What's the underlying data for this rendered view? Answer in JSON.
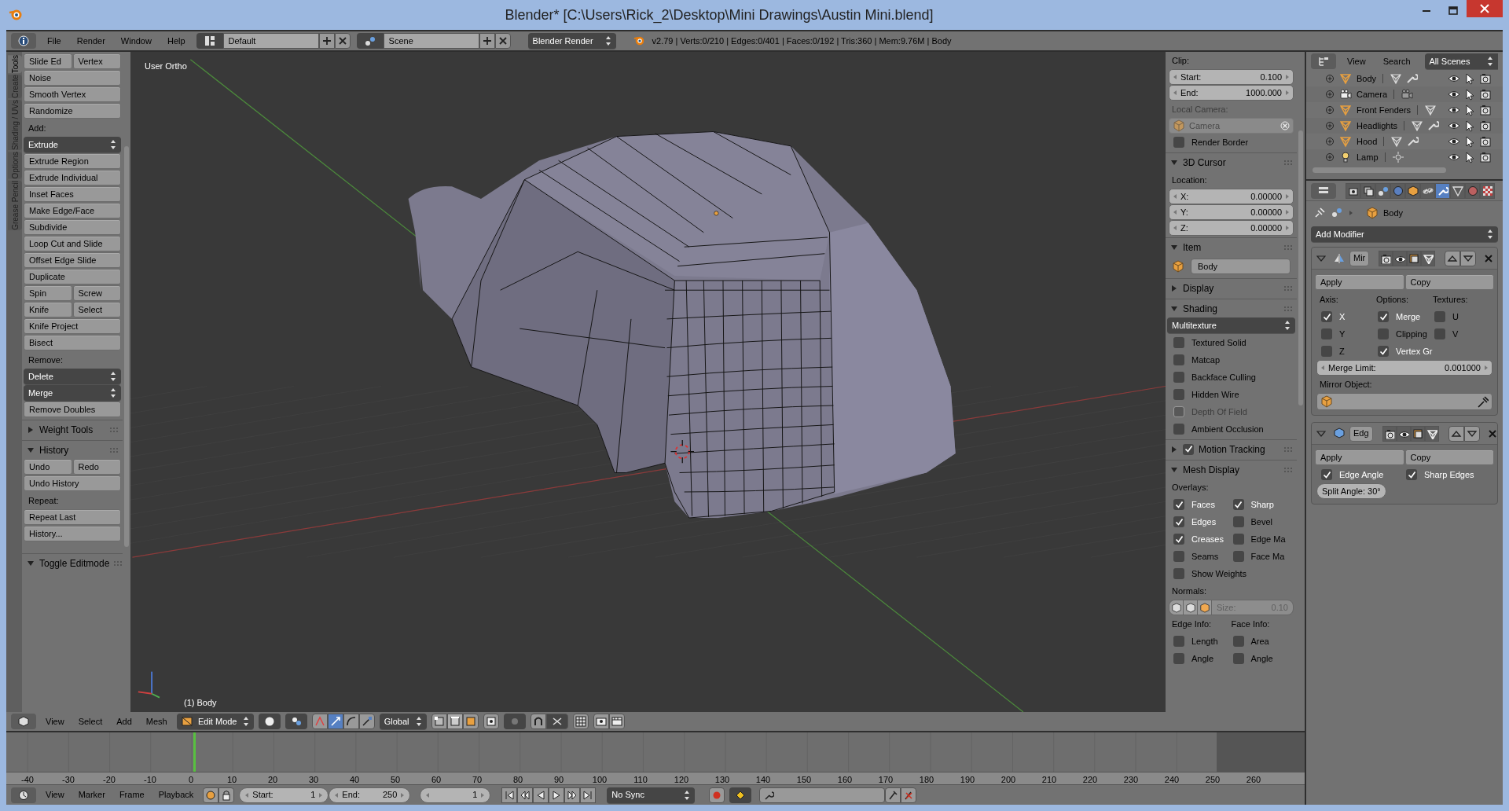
{
  "window": {
    "title": "Blender* [C:\\Users\\Rick_2\\Desktop\\Mini Drawings\\Austin Mini.blend]"
  },
  "info_header": {
    "menus": [
      "File",
      "Render",
      "Window",
      "Help"
    ],
    "screen_layout": "Default",
    "scene": "Scene",
    "render_engine": "Blender Render",
    "stats": "v2.79 | Verts:0/210 | Edges:0/401 | Faces:0/192 | Tris:360 | Mem:9.76M | Body"
  },
  "tool_shelf": {
    "tabs": [
      {
        "label": "Tools",
        "selected": true
      },
      {
        "label": "Create",
        "selected": false
      },
      {
        "label": "Shading / UVs",
        "selected": false
      },
      {
        "label": "Options",
        "selected": false
      },
      {
        "label": "Grease Pencil",
        "selected": false
      }
    ],
    "rows": [
      {
        "kind": "buttons",
        "labels": [
          "Slide Ed",
          "Vertex"
        ]
      },
      {
        "kind": "buttons",
        "labels": [
          "Noise"
        ]
      },
      {
        "kind": "buttons",
        "labels": [
          "Smooth Vertex"
        ]
      },
      {
        "kind": "buttons",
        "labels": [
          "Randomize"
        ]
      },
      {
        "kind": "label",
        "text": "Add:"
      },
      {
        "kind": "dropdown",
        "text": "Extrude"
      },
      {
        "kind": "buttons",
        "labels": [
          "Extrude Region"
        ]
      },
      {
        "kind": "buttons",
        "labels": [
          "Extrude Individual"
        ]
      },
      {
        "kind": "buttons",
        "labels": [
          "Inset Faces"
        ]
      },
      {
        "kind": "buttons",
        "labels": [
          "Make Edge/Face"
        ]
      },
      {
        "kind": "buttons",
        "labels": [
          "Subdivide"
        ]
      },
      {
        "kind": "buttons",
        "labels": [
          "Loop Cut and Slide"
        ]
      },
      {
        "kind": "buttons",
        "labels": [
          "Offset Edge Slide"
        ]
      },
      {
        "kind": "buttons",
        "labels": [
          "Duplicate"
        ]
      },
      {
        "kind": "buttons",
        "labels": [
          "Spin",
          "Screw"
        ]
      },
      {
        "kind": "buttons",
        "labels": [
          "Knife",
          "Select"
        ]
      },
      {
        "kind": "buttons",
        "labels": [
          "Knife Project"
        ]
      },
      {
        "kind": "buttons",
        "labels": [
          "Bisect"
        ]
      },
      {
        "kind": "label",
        "text": "Remove:"
      },
      {
        "kind": "dropdown",
        "text": "Delete"
      },
      {
        "kind": "dropdown",
        "text": "Merge"
      },
      {
        "kind": "buttons",
        "labels": [
          "Remove Doubles"
        ]
      },
      {
        "kind": "panel",
        "text": "Weight Tools",
        "expanded": false
      },
      {
        "kind": "panel",
        "text": "History",
        "expanded": true
      },
      {
        "kind": "buttons",
        "labels": [
          "Undo",
          "Redo"
        ]
      },
      {
        "kind": "buttons",
        "labels": [
          "Undo History"
        ]
      },
      {
        "kind": "label",
        "text": "Repeat:"
      },
      {
        "kind": "buttons",
        "labels": [
          "Repeat Last"
        ]
      },
      {
        "kind": "buttons",
        "labels": [
          "History..."
        ]
      }
    ],
    "footer_panel": {
      "text": "Toggle Editmode",
      "expanded": true
    }
  },
  "viewport": {
    "view_name": "User Ortho",
    "object_label": "(1) Body"
  },
  "properties_region": {
    "rows": [
      {
        "kind": "label",
        "text": "Clip:",
        "disabled": false
      },
      {
        "kind": "number",
        "label": "Start:",
        "value": "0.100"
      },
      {
        "kind": "number",
        "label": "End:",
        "value": "1000.000"
      },
      {
        "kind": "label",
        "text": "Local Camera:",
        "disabled": true
      },
      {
        "kind": "object_field",
        "text": "Camera",
        "disabled": true
      },
      {
        "kind": "check",
        "label": "Render Border",
        "checked": false,
        "disabled": false
      },
      {
        "kind": "panel",
        "text": "3D Cursor",
        "expanded": true
      },
      {
        "kind": "label",
        "text": "Location:",
        "disabled": false
      },
      {
        "kind": "number",
        "label": "X:",
        "value": "0.00000"
      },
      {
        "kind": "number",
        "label": "Y:",
        "value": "0.00000"
      },
      {
        "kind": "number",
        "label": "Z:",
        "value": "0.00000"
      },
      {
        "kind": "panel",
        "text": "Item",
        "expanded": true
      },
      {
        "kind": "item_name",
        "text": "Body"
      },
      {
        "kind": "panel",
        "text": "Display",
        "expanded": false
      },
      {
        "kind": "panel",
        "text": "Shading",
        "expanded": true
      },
      {
        "kind": "dropdown",
        "text": "Multitexture"
      },
      {
        "kind": "check",
        "label": "Textured Solid",
        "checked": false,
        "disabled": false
      },
      {
        "kind": "check",
        "label": "Matcap",
        "checked": false,
        "disabled": false
      },
      {
        "kind": "check",
        "label": "Backface Culling",
        "checked": false,
        "disabled": false
      },
      {
        "kind": "check",
        "label": "Hidden Wire",
        "checked": false,
        "disabled": false
      },
      {
        "kind": "check",
        "label": "Depth Of Field",
        "checked": false,
        "disabled": true
      },
      {
        "kind": "check",
        "label": "Ambient Occlusion",
        "checked": false,
        "disabled": false
      },
      {
        "kind": "panel",
        "text": "Motion Tracking",
        "expanded": false,
        "checked": true
      },
      {
        "kind": "panel",
        "text": "Mesh Display",
        "expanded": true
      },
      {
        "kind": "label",
        "text": "Overlays:",
        "disabled": false
      },
      {
        "kind": "check_columns",
        "columns": [
          {
            "items": [
              {
                "label": "Faces",
                "checked": true
              },
              {
                "label": "Edges",
                "checked": true
              },
              {
                "label": "Creases",
                "checked": true
              },
              {
                "label": "Seams",
                "checked": false
              }
            ]
          },
          {
            "items": [
              {
                "label": "Sharp",
                "checked": true
              },
              {
                "label": "Bevel",
                "checked": false
              },
              {
                "label": "Edge Ma",
                "checked": false
              },
              {
                "label": "Face Ma",
                "checked": false
              }
            ]
          }
        ]
      },
      {
        "kind": "check",
        "label": "Show Weights",
        "checked": false,
        "disabled": false
      },
      {
        "kind": "label",
        "text": "Normals:",
        "disabled": false
      },
      {
        "kind": "normals",
        "label": "Size:",
        "value": "0.10"
      },
      {
        "kind": "check_columns",
        "columns": [
          {
            "heading": "Edge Info:",
            "items": [
              {
                "label": "Length",
                "checked": false
              },
              {
                "label": "Angle",
                "checked": false
              }
            ]
          },
          {
            "heading": "Face Info:",
            "items": [
              {
                "label": "Area",
                "checked": false
              },
              {
                "label": "Angle",
                "checked": false
              }
            ]
          }
        ]
      }
    ]
  },
  "header_3d": {
    "menus": [
      "View",
      "Select",
      "Add",
      "Mesh"
    ],
    "mode": "Edit Mode",
    "orientation": "Global"
  },
  "timeline": {
    "ticks": [
      "-40",
      "-30",
      "-20",
      "-10",
      "0",
      "10",
      "20",
      "30",
      "40",
      "50",
      "60",
      "70",
      "80",
      "90",
      "100",
      "110",
      "120",
      "130",
      "140",
      "150",
      "160",
      "170",
      "180",
      "190",
      "200",
      "210",
      "220",
      "230",
      "240",
      "250",
      "260"
    ],
    "playhead": {
      "level": 0.136
    },
    "out_of_range": {
      "level": 0.97
    },
    "menus": [
      "View",
      "Marker",
      "Frame",
      "Playback"
    ],
    "start_label": "Start:",
    "start": "1",
    "end_label": "End:",
    "end": "250",
    "current_frame": "1",
    "sync": "No Sync"
  },
  "outliner": {
    "menus": [
      "View",
      "Search"
    ],
    "filter": "All Scenes",
    "rows": [
      {
        "name": "Body",
        "kind": "mesh",
        "modifiers": true
      },
      {
        "name": "Camera",
        "kind": "camera",
        "modifiers": false
      },
      {
        "name": "Front Fenders",
        "kind": "mesh",
        "modifiers": false
      },
      {
        "name": "Headlights",
        "kind": "mesh",
        "modifiers": true
      },
      {
        "name": "Hood",
        "kind": "mesh",
        "modifiers": true
      },
      {
        "name": "Lamp",
        "kind": "lamp",
        "modifiers": false
      }
    ]
  },
  "properties_editor": {
    "tabs": [
      {
        "selected": false
      },
      {
        "selected": false
      },
      {
        "selected": false
      },
      {
        "selected": false
      },
      {
        "selected": false
      },
      {
        "selected": false
      },
      {
        "selected": true
      },
      {
        "selected": false
      },
      {
        "selected": false
      },
      {
        "selected": false
      }
    ],
    "breadcrumb": "Body",
    "add_modifier": "Add Modifier",
    "modifiers": [
      {
        "name": "Mir",
        "kind": "mirror",
        "expanded": true,
        "rows": [
          {
            "kind": "buttons",
            "labels": [
              "Apply",
              "Copy"
            ]
          },
          {
            "kind": "check_columns",
            "columns": [
              {
                "heading": "Axis:",
                "items": [
                  {
                    "label": "X",
                    "checked": true
                  },
                  {
                    "label": "Y",
                    "checked": false
                  },
                  {
                    "label": "Z",
                    "checked": false
                  }
                ]
              },
              {
                "heading": "Options:",
                "items": [
                  {
                    "label": "Merge",
                    "checked": true
                  },
                  {
                    "label": "Clipping",
                    "checked": false
                  },
                  {
                    "label": "Vertex Gr",
                    "checked": true
                  }
                ]
              },
              {
                "heading": "Textures:",
                "items": [
                  {
                    "label": "U",
                    "checked": false
                  },
                  {
                    "label": "V",
                    "checked": false
                  }
                ]
              }
            ]
          },
          {
            "kind": "number",
            "label": "Merge Limit:",
            "value": "0.001000"
          },
          {
            "kind": "label",
            "text": "Mirror Object:",
            "disabled": false
          },
          {
            "kind": "object_picker"
          }
        ]
      },
      {
        "name": "Edg",
        "kind": "edge_split",
        "expanded": true,
        "rows": [
          {
            "kind": "buttons",
            "labels": [
              "Apply",
              "Copy"
            ]
          },
          {
            "kind": "check_columns",
            "columns": [
              {
                "items": [
                  {
                    "label": "Edge Angle",
                    "checked": true
                  }
                ]
              },
              {
                "items": [
                  {
                    "label": "Sharp Edges",
                    "checked": true
                  }
                ]
              }
            ]
          },
          {
            "kind": "compact_number",
            "text": "Split Angle: 30°"
          }
        ]
      }
    ]
  }
}
